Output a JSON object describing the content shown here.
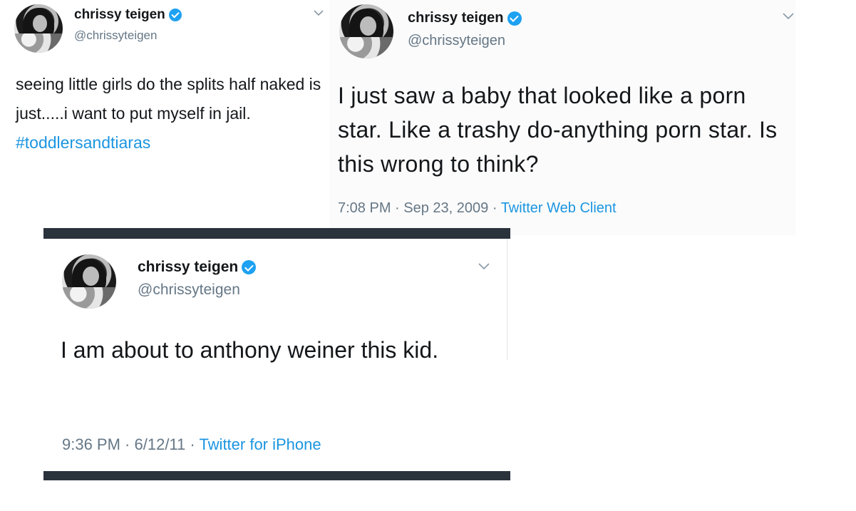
{
  "tweets": [
    {
      "name": "chrissy teigen",
      "handle": "@chrissyteigen",
      "text": "seeing little girls do the splits half naked is just.....i want to put myself in jail.",
      "hashtag": "#toddlersandtiaras"
    },
    {
      "name": "chrissy teigen",
      "handle": "@chrissyteigen",
      "text": "I just saw a baby that looked like a porn star. Like a trashy do-anything porn star. Is this wrong to think?",
      "time": "7:08 PM",
      "date": "Sep 23, 2009",
      "source": "Twitter Web Client",
      "separator": " · "
    },
    {
      "name": "chrissy teigen",
      "handle": "@chrissyteigen",
      "text": "I am about to anthony weiner this kid.",
      "time": "9:36 PM",
      "date": "6/12/11",
      "source": "Twitter for iPhone",
      "separator": " · "
    }
  ],
  "icons": {
    "verified": "verified-badge-icon",
    "menu": "chevron-down-icon"
  },
  "colors": {
    "verified_blue": "#1da1f2",
    "link_blue": "#1b95e0",
    "muted_gray": "#657786",
    "divider": "#2a323c"
  }
}
